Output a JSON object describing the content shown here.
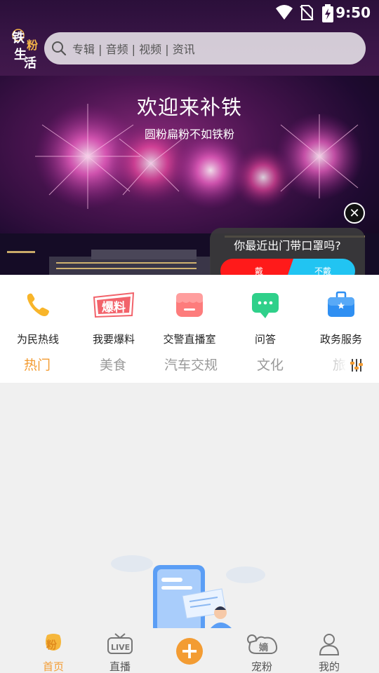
{
  "status_bar": {
    "time": "9:50"
  },
  "header": {
    "logo_text": "铁粉生活",
    "search_placeholder": "专辑 | 音频 | 视频 | 资讯"
  },
  "banner": {
    "title": "欢迎来补铁",
    "subtitle": "圆粉扁粉不如铁粉"
  },
  "poll": {
    "question": "你最近出门带口罩吗?",
    "option_yes": "戴",
    "option_no": "不戴",
    "yes_color": "#ff1a1a",
    "no_color": "#21c4f2"
  },
  "quick_entries": [
    {
      "label": "为民热线",
      "icon": "phone-icon"
    },
    {
      "label": "我要爆料",
      "icon": "baoliao-icon"
    },
    {
      "label": "交警直播室",
      "icon": "store-icon"
    },
    {
      "label": "问答",
      "icon": "chat-icon"
    },
    {
      "label": "政务服务",
      "icon": "briefcase-icon"
    }
  ],
  "tabs": [
    {
      "label": "热门",
      "active": true
    },
    {
      "label": "美食",
      "active": false
    },
    {
      "label": "汽车交规",
      "active": false
    },
    {
      "label": "文化",
      "active": false
    },
    {
      "label": "旅",
      "active": false
    }
  ],
  "bottom_nav": [
    {
      "label": "首页",
      "icon": "home-icon",
      "active": true
    },
    {
      "label": "直播",
      "icon": "live-icon",
      "active": false
    },
    {
      "label": "宠粉",
      "icon": "pet-icon",
      "active": false
    },
    {
      "label": "我的",
      "icon": "user-icon",
      "active": false
    }
  ],
  "nav_live_badge": "LIVE",
  "nav_pet_badge": "嫡",
  "accent_color": "#f39c33"
}
